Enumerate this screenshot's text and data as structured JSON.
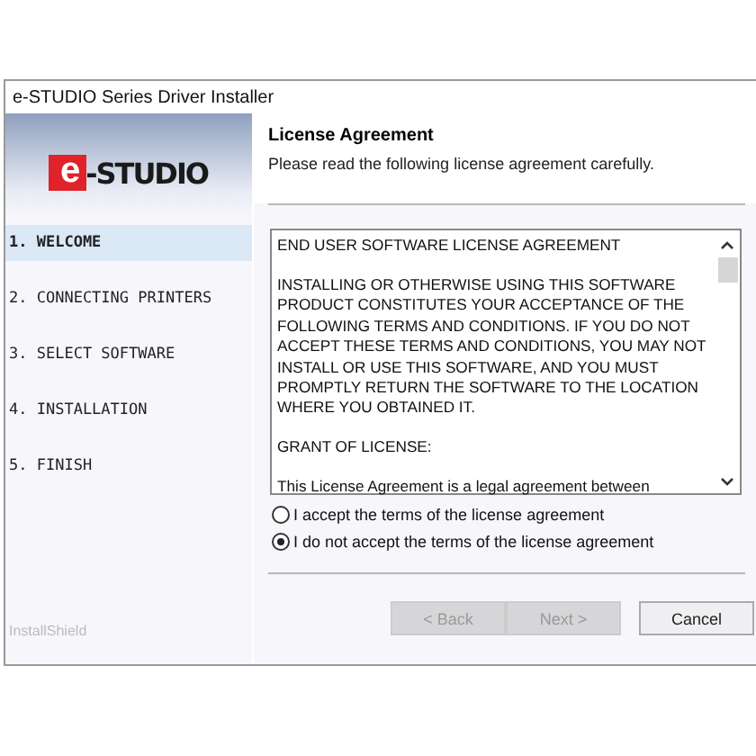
{
  "window": {
    "title": "e-STUDIO Series Driver Installer"
  },
  "logo": {
    "mark": "e",
    "text": "-STUDIO"
  },
  "steps": [
    {
      "label": "1. WELCOME",
      "selected": true
    },
    {
      "label": "2. CONNECTING PRINTERS",
      "selected": false
    },
    {
      "label": "3. SELECT SOFTWARE",
      "selected": false
    },
    {
      "label": "4. INSTALLATION",
      "selected": false
    },
    {
      "label": "5. FINISH",
      "selected": false
    }
  ],
  "brand": "InstallShield",
  "header": {
    "title": "License Agreement",
    "subtitle": "Please read the following license agreement carefully."
  },
  "license_text": [
    "END USER SOFTWARE LICENSE AGREEMENT",
    "INSTALLING OR OTHERWISE USING THIS SOFTWARE PRODUCT CONSTITUTES YOUR ACCEPTANCE OF THE FOLLOWING TERMS AND CONDITIONS. IF YOU DO NOT ACCEPT THESE TERMS AND CONDITIONS, YOU MAY NOT INSTALL OR USE THIS SOFTWARE, AND YOU MUST PROMPTLY RETURN THE SOFTWARE TO THE LOCATION WHERE YOU OBTAINED IT.",
    "GRANT OF LICENSE:",
    "This License Agreement is a legal agreement between"
  ],
  "options": [
    {
      "label": "I accept the terms of the license agreement",
      "selected": false
    },
    {
      "label": "I do not accept the terms of the license agreement",
      "selected": true
    }
  ],
  "buttons": [
    {
      "label": "< Back",
      "disabled": true
    },
    {
      "label": "Next >",
      "disabled": true
    },
    {
      "label": "Cancel",
      "disabled": false
    }
  ]
}
